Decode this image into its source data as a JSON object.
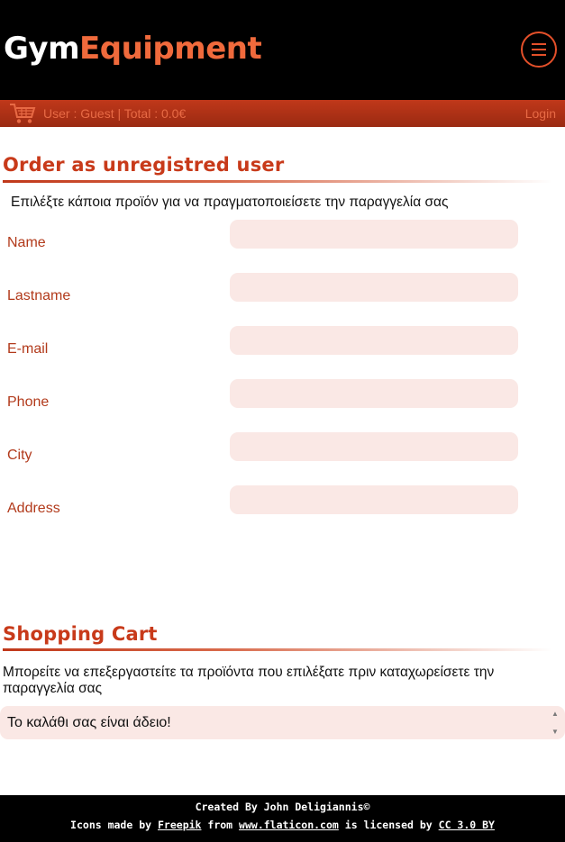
{
  "header": {
    "logo_part1": "Gym",
    "logo_part2": "Equipment",
    "menu_icon": "hamburger-menu-icon"
  },
  "userbar": {
    "cart_icon": "shopping-cart-icon",
    "user_info": "User : Guest | Total : 0.0€",
    "login_label": "Login"
  },
  "order": {
    "title": "Order as unregistred user",
    "instructions": "Επιλέξτε κάποια προϊόν για να πραγματοποιείσετε την παραγγελία σας",
    "fields": [
      {
        "label": "Name",
        "value": ""
      },
      {
        "label": "Lastname",
        "value": ""
      },
      {
        "label": "E-mail",
        "value": ""
      },
      {
        "label": "Phone",
        "value": ""
      },
      {
        "label": "City",
        "value": ""
      },
      {
        "label": "Address",
        "value": ""
      }
    ]
  },
  "cart": {
    "title": "Shopping Cart",
    "description": "Μπορείτε να επεξεργαστείτε τα προϊόντα που επιλέξατε πριν καταχωρείσετε την παραγγελία σας",
    "empty_message": "Το καλάθι σας είναι άδειο!"
  },
  "footer": {
    "credit": "Created By John Deligiannis©",
    "icons_prefix": "Icons made by",
    "freepik": "Freepik",
    "from": "from",
    "flaticon": "www.flaticon.com",
    "licensed": "is licensed by",
    "license": "CC 3.0 BY"
  },
  "colors": {
    "accent": "#e4502a",
    "bar": "#b0331a",
    "input_bg": "#fae8e5"
  }
}
